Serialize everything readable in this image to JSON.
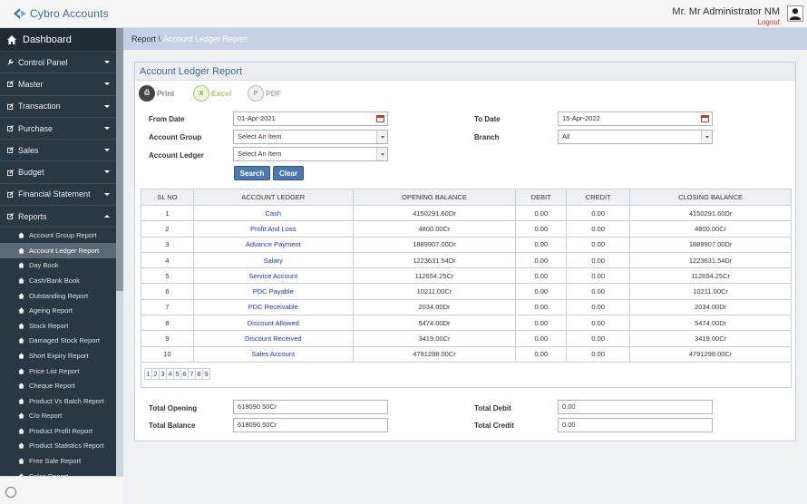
{
  "app": {
    "name": "Cybro Accounts"
  },
  "user": {
    "name": "Mr. Mr Administrator NM",
    "logout": "Logout"
  },
  "sidebar": {
    "dashboard": "Dashboard",
    "items": [
      {
        "label": "Control Panel"
      },
      {
        "label": "Master"
      },
      {
        "label": "Transaction"
      },
      {
        "label": "Purchase"
      },
      {
        "label": "Sales"
      },
      {
        "label": "Budget"
      },
      {
        "label": "Financial Statement"
      },
      {
        "label": "Reports"
      }
    ],
    "reports": [
      "Account Group Report",
      "Account Ledger Report",
      "Day Book",
      "Cash/Bank Book",
      "Outstanding Report",
      "Ageing Report",
      "Stock Report",
      "Damaged Stock Report",
      "Short Expiry Report",
      "Price List Report",
      "Cheque Report",
      "Product Vs Batch Report",
      "C/o Report",
      "Product Profit Report",
      "Product Statistics Report",
      "Free Sale Report",
      "Sales Report"
    ]
  },
  "breadcrumb": {
    "parent": "Report \\",
    "current": "Account Ledger Report"
  },
  "panel": {
    "title": "Account Ledger Report"
  },
  "export": {
    "print": "Print",
    "excel": "Excel",
    "pdf": "PDF"
  },
  "filters": {
    "from_date_label": "From Date",
    "from_date": "01-Apr-2021",
    "to_date_label": "To Date",
    "to_date": "15-Apr-2022",
    "account_group_label": "Account Group",
    "account_group": "Select An Item",
    "branch_label": "Branch",
    "branch": "All",
    "account_ledger_label": "Account Ledger",
    "account_ledger": "Select An Item",
    "search": "Search",
    "clear": "Clear"
  },
  "table": {
    "headers": [
      "SL NO",
      "ACCOUNT LEDGER",
      "OPENING BALANCE",
      "DEBIT",
      "CREDIT",
      "CLOSING BALANCE"
    ],
    "rows": [
      [
        "1",
        "Cash",
        "4150291.60Dr",
        "0.00",
        "0.00",
        "4150291.60Dr"
      ],
      [
        "2",
        "Profit And Loss",
        "4800.00Cr",
        "0.00",
        "0.00",
        "4800.00Cr"
      ],
      [
        "3",
        "Advance Payment",
        "1889907.00Dr",
        "0.00",
        "0.00",
        "1889907.00Dr"
      ],
      [
        "4",
        "Salary",
        "1223631.54Dr",
        "0.00",
        "0.00",
        "1223631.54Dr"
      ],
      [
        "5",
        "Service Account",
        "112654.25Cr",
        "0.00",
        "0.00",
        "112654.25Cr"
      ],
      [
        "6",
        "PDC Payable",
        "10211.00Cr",
        "0.00",
        "0.00",
        "10211.00Cr"
      ],
      [
        "7",
        "PDC Receivable",
        "2034.00Dr",
        "0.00",
        "0.00",
        "2034.00Dr"
      ],
      [
        "8",
        "Discount Allowed",
        "5474.00Dr",
        "0.00",
        "0.00",
        "5474.00Dr"
      ],
      [
        "9",
        "Discount Received",
        "3419.00Cr",
        "0.00",
        "0.00",
        "3419.00Cr"
      ],
      [
        "10",
        "Sales Account",
        "4791298.00Cr",
        "0.00",
        "0.00",
        "4791298.00Cr"
      ]
    ],
    "pages": [
      "1",
      "2",
      "3",
      "4",
      "5",
      "6",
      "7",
      "8",
      "9"
    ]
  },
  "totals": {
    "opening_label": "Total Opening",
    "opening": "618090.50Cr",
    "balance_label": "Total Balance",
    "balance": "618090.50Cr",
    "debit_label": "Total Debit",
    "debit": "0.00",
    "credit_label": "Total Credit",
    "credit": "0.00"
  },
  "colors": {
    "accent": "#3a6c96",
    "sidebar": "#2a3844",
    "link": "#1a35c8",
    "button": "#4b79ad"
  }
}
